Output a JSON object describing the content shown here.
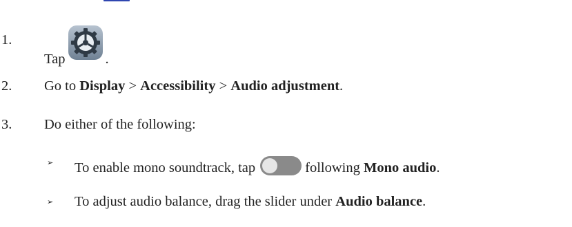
{
  "steps": [
    {
      "num": "1.",
      "before": "Tap",
      "after": "."
    },
    {
      "num": "2.",
      "prefix": "Go to ",
      "b1": "Display",
      "sep1": " > ",
      "b2": "Accessibility",
      "sep2": " > ",
      "b3": "Audio adjustment",
      "suffix": "."
    },
    {
      "num": "3.",
      "text": "Do either of the following:"
    }
  ],
  "bullets": [
    {
      "glyph": "➢",
      "before": "To enable mono soundtrack, tap",
      "after": "following",
      "bold": "Mono audio",
      "suffix": "."
    },
    {
      "glyph": "➢",
      "before": "To adjust audio balance, drag the slider under ",
      "bold": "Audio balance",
      "suffix": "."
    }
  ],
  "icons": {
    "settings": "settings-gear-icon",
    "toggle": "toggle-switch-off-icon"
  },
  "colors": {
    "text": "#222222",
    "icon_bg": "#8fa0b3",
    "toggle_bg": "#8a8a8a",
    "accent": "#2f46b0"
  }
}
